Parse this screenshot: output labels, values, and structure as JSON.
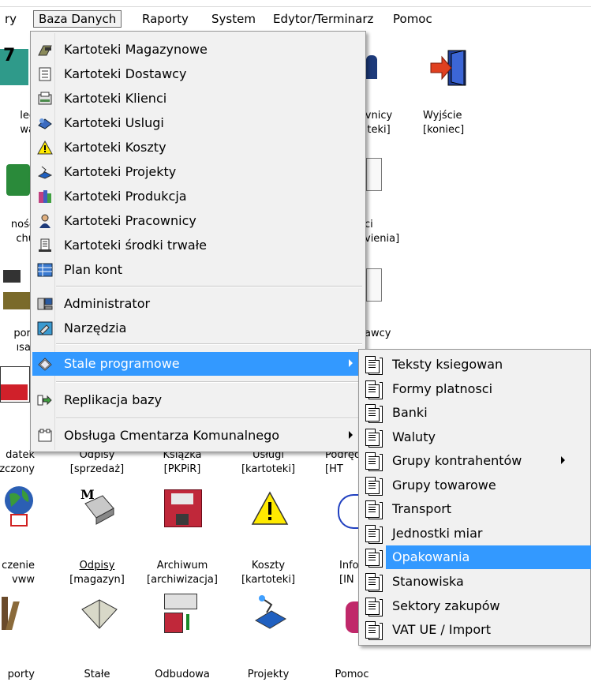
{
  "menubar": {
    "items": [
      {
        "label": "ry",
        "active": false
      },
      {
        "label": "Baza Danych",
        "active": true
      },
      {
        "label": "Raporty",
        "active": false
      },
      {
        "label": "System",
        "active": false
      },
      {
        "label": "Edytor/Terminarz",
        "active": false
      },
      {
        "label": "Pomoc",
        "active": false
      }
    ]
  },
  "dropdown": {
    "items": [
      {
        "label": "Kartoteki Magazynowe",
        "icon": "warehouse-icon"
      },
      {
        "label": "Kartoteki Dostawcy",
        "icon": "supplier-icon"
      },
      {
        "label": "Kartoteki Klienci",
        "icon": "clients-icon"
      },
      {
        "label": "Kartoteki Uslugi",
        "icon": "services-icon"
      },
      {
        "label": "Kartoteki Koszty",
        "icon": "warning-icon"
      },
      {
        "label": "Kartoteki Projekty",
        "icon": "projects-icon"
      },
      {
        "label": "Kartoteki Produkcja",
        "icon": "production-icon"
      },
      {
        "label": "Kartoteki Pracownicy",
        "icon": "employee-icon"
      },
      {
        "label": "Kartoteki środki trwałe",
        "icon": "fixed-assets-icon"
      },
      {
        "label": "Plan kont",
        "icon": "chart-of-accounts-icon"
      },
      {
        "label": "Administrator",
        "icon": "administrator-icon"
      },
      {
        "label": "Narzędzia",
        "icon": "tools-icon"
      },
      {
        "label": "Stale programowe",
        "icon": "eraser-icon"
      },
      {
        "label": "Replikacja bazy",
        "icon": "replication-icon"
      },
      {
        "label": "Obsługa Cmentarza Komunalnego",
        "icon": "cemetery-icon"
      }
    ]
  },
  "submenu": {
    "items": [
      {
        "label": "Teksty ksiegowan"
      },
      {
        "label": "Formy platnosci"
      },
      {
        "label": "Banki"
      },
      {
        "label": "Waluty"
      },
      {
        "label": "Grupy kontrahentów"
      },
      {
        "label": "Grupy towarowe"
      },
      {
        "label": "Transport"
      },
      {
        "label": "Jednostki miar"
      },
      {
        "label": "Opakowania"
      },
      {
        "label": "Stanowiska"
      },
      {
        "label": "Sektory zakupów"
      },
      {
        "label": "VAT UE / Import"
      }
    ]
  },
  "desktop": {
    "top_right": {
      "l1": "vnicy",
      "l2": "teki]"
    },
    "exit": {
      "l1": "Wyjście",
      "l2": "[koniec]"
    },
    "left1": {
      "l1": "lec",
      "l2": "wa"
    },
    "left2": {
      "l1": "nośc",
      "l2": "chu"
    },
    "mid_right": {
      "l1": "ci",
      "l2": "vienia]"
    },
    "left3": {
      "l1": "port",
      "l2": "ısa]"
    },
    "right3": {
      "l1": "awcy"
    },
    "row_a": [
      {
        "l1": "datek",
        "l2": "zczony"
      },
      {
        "l1": "Odpisy",
        "l2": "[sprzedaż]"
      },
      {
        "l1": "Książka",
        "l2": "[PKPiR]"
      },
      {
        "l1": "Usługi",
        "l2": "[kartoteki]"
      },
      {
        "l1": "Podręc",
        "l2": "[HT"
      }
    ],
    "row_b": [
      {
        "l1": "czenie",
        "l2": "vww"
      },
      {
        "l1": "Odpisy",
        "l2": "[magazyn]"
      },
      {
        "l1": "Archiwum",
        "l2": "[archiwizacja]"
      },
      {
        "l1": "Koszty",
        "l2": "[kartoteki]"
      },
      {
        "l1": "Infor",
        "l2": "[IN"
      }
    ],
    "row_c": [
      {
        "l1": "porty"
      },
      {
        "l1": "Stałe"
      },
      {
        "l1": "Odbudowa"
      },
      {
        "l1": "Projekty"
      },
      {
        "l1": "Pomoc"
      }
    ]
  },
  "colors": {
    "highlight": "#3399ff",
    "menu_bg": "#f1f1f1"
  }
}
